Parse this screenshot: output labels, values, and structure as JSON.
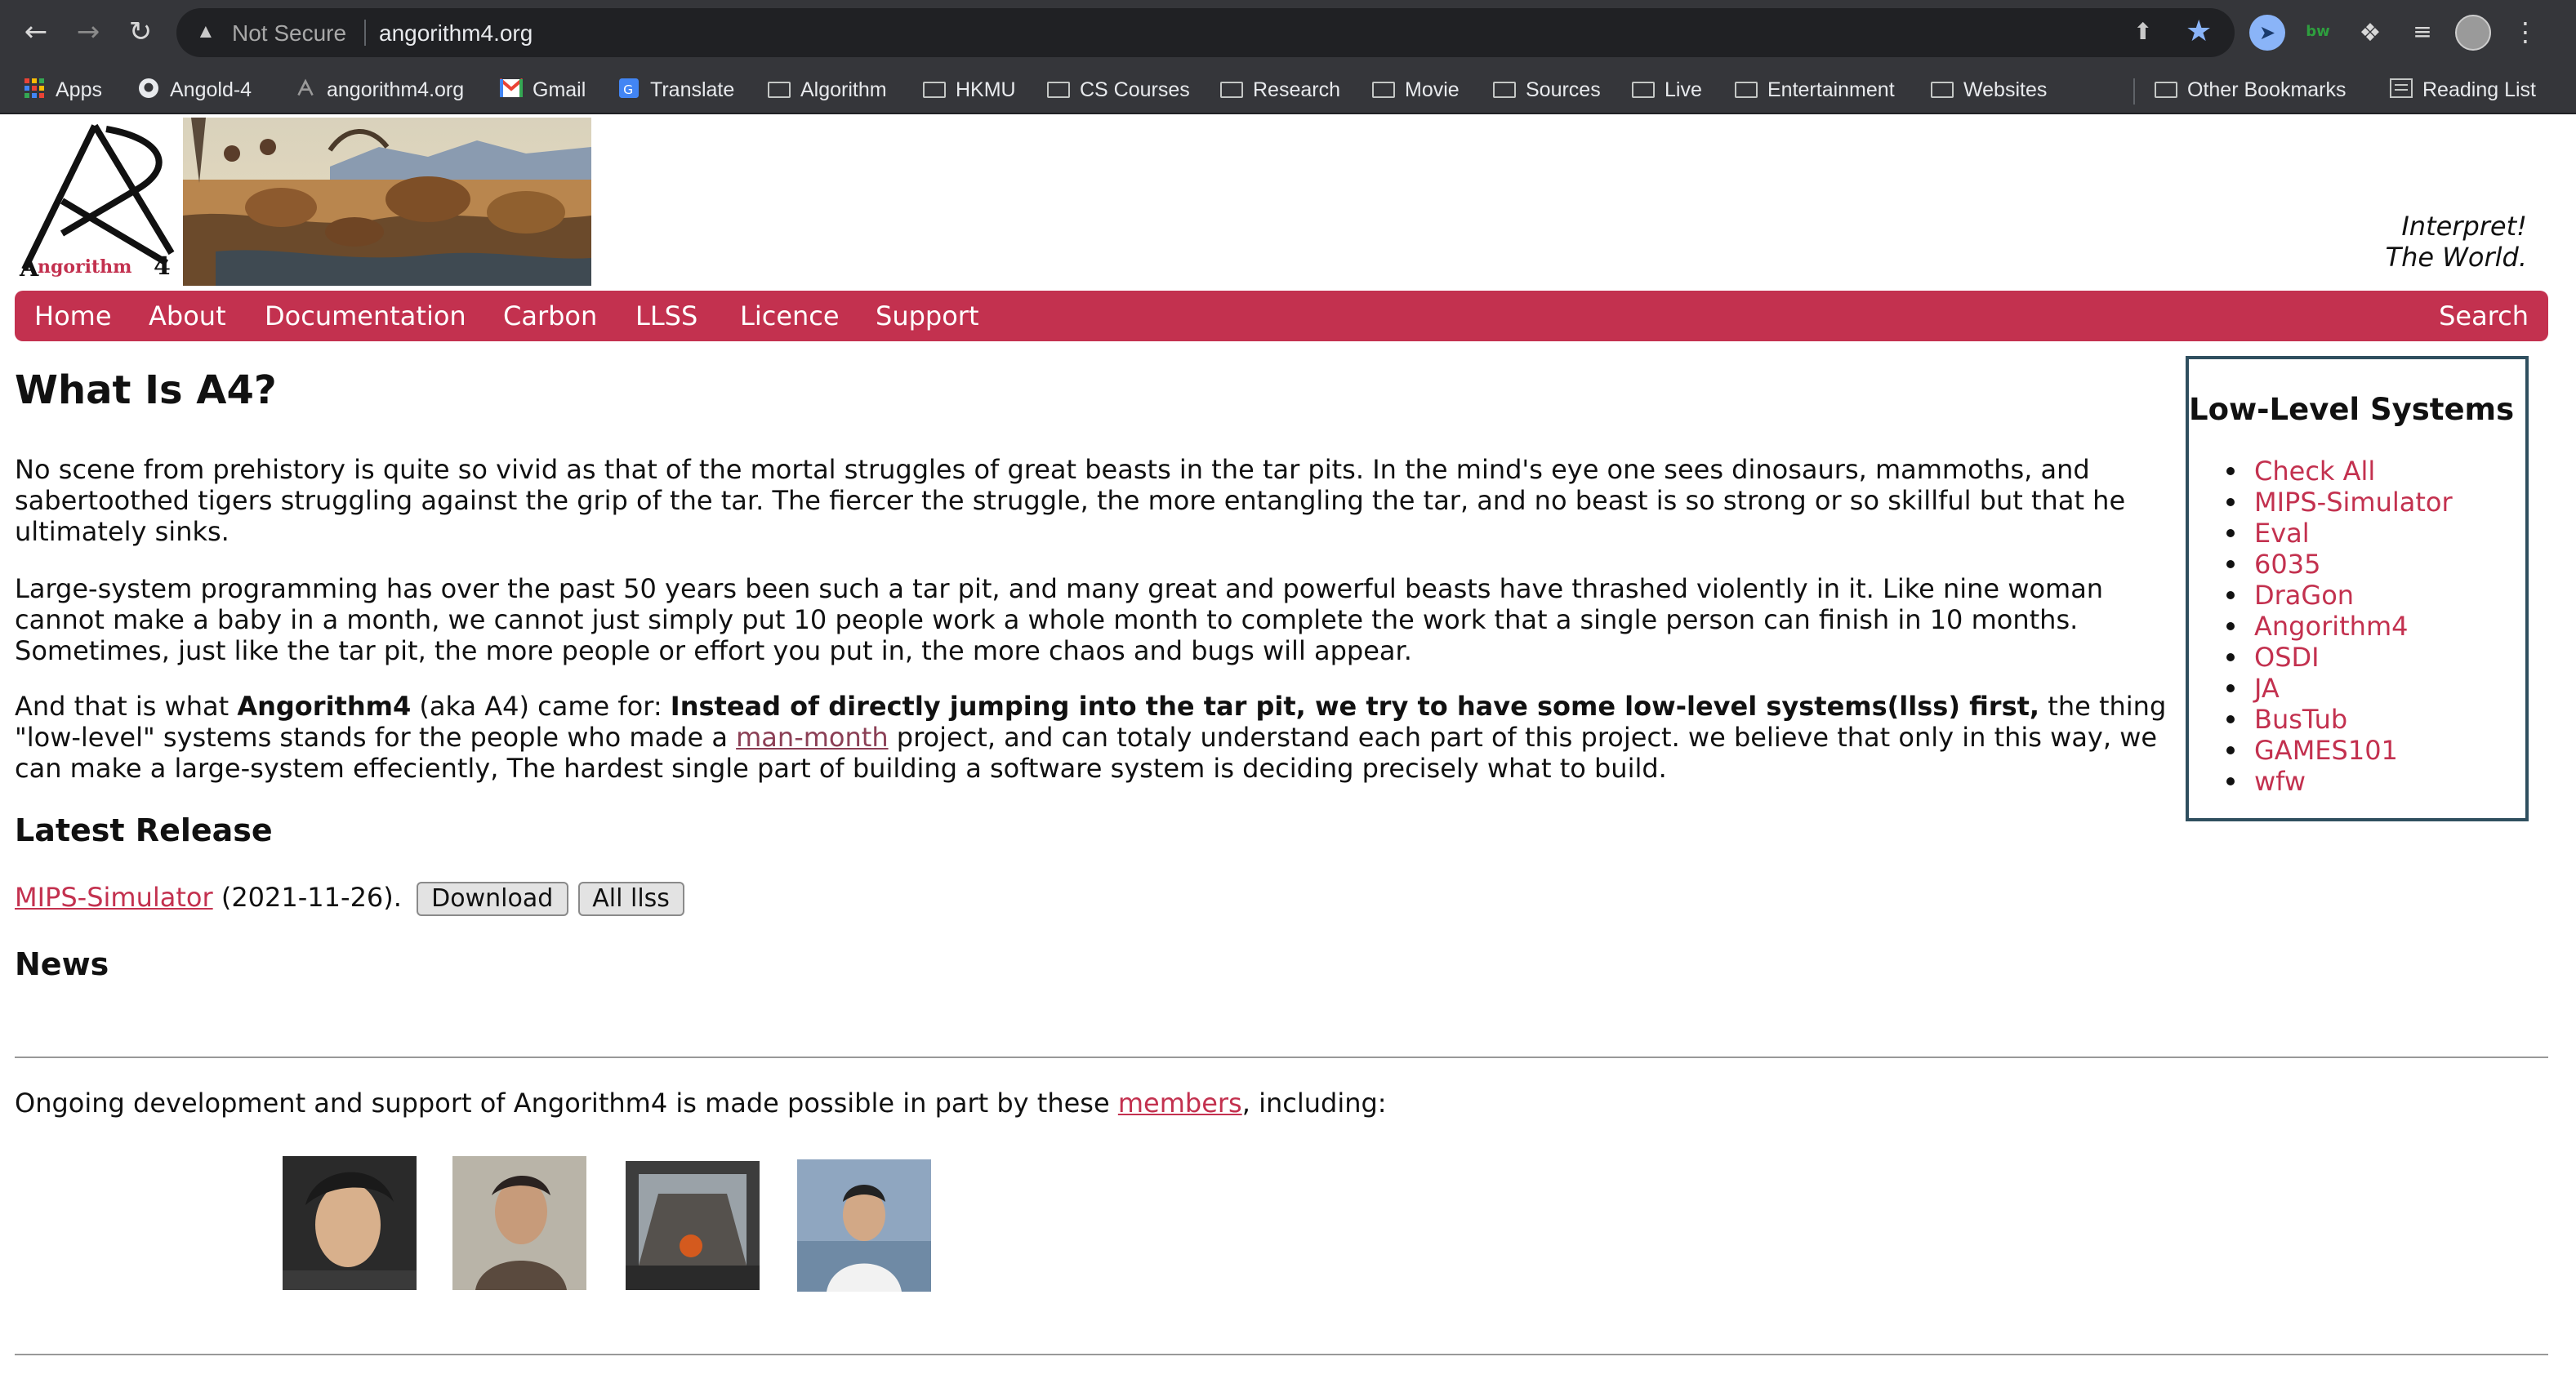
{
  "browser": {
    "security_label": "Not Secure",
    "url": "angorithm4.org",
    "extension_text": "bw",
    "bookmarks": [
      {
        "label": "Apps",
        "icon": "apps-grid-icon"
      },
      {
        "label": "Angold-4",
        "icon": "github-icon"
      },
      {
        "label": "angorithm4.org",
        "icon": "site-favicon-icon"
      },
      {
        "label": "Gmail",
        "icon": "gmail-icon"
      },
      {
        "label": "Translate",
        "icon": "translate-icon"
      },
      {
        "label": "Algorithm",
        "icon": "folder-icon"
      },
      {
        "label": "HKMU",
        "icon": "folder-icon"
      },
      {
        "label": "CS Courses",
        "icon": "folder-icon"
      },
      {
        "label": "Research",
        "icon": "folder-icon"
      },
      {
        "label": "Movie",
        "icon": "folder-icon"
      },
      {
        "label": "Sources",
        "icon": "folder-icon"
      },
      {
        "label": "Live",
        "icon": "folder-icon"
      },
      {
        "label": "Entertainment",
        "icon": "folder-icon"
      },
      {
        "label": "Websites",
        "icon": "folder-icon"
      }
    ],
    "other_bookmarks": "Other Bookmarks",
    "reading_list": "Reading List"
  },
  "site": {
    "logo_text": "Angorithm4",
    "tagline_line1": "Interpret!",
    "tagline_line2": "The World.",
    "nav": [
      "Home",
      "About",
      "Documentation",
      "Carbon",
      "LLSS",
      "Licence",
      "Support"
    ],
    "nav_search": "Search"
  },
  "main": {
    "title": "What Is A4?",
    "para1": "No scene from prehistory is quite so vivid as that of the mortal struggles of great beasts in the tar pits. In the mind's eye one sees dinosaurs, mammoths, and sabertoothed tigers struggling against the grip of the tar. The fiercer the struggle, the more entangling the tar, and no beast is so strong or so skillful but that he ultimately sinks.",
    "para2": "Large-system programming has over the past 50 years been such a tar pit, and many great and powerful beasts have thrashed violently in it. Like nine woman cannot make a baby in a month, we cannot just simply put 10 people work a whole month to complete the work that a single person can finish in 10 months. Sometimes, just like the tar pit, the more people or effort you put in, the more chaos and bugs will appear.",
    "para3_a": "And that is what ",
    "para3_b": "Angorithm4",
    "para3_c": " (aka A4) came for: ",
    "para3_d": "Instead of directly jumping into the tar pit, we try to have some low-level systems(llss) first,",
    "para3_e": " the thing \"low-level\" systems stands for the people who made a ",
    "para3_link": "man-month",
    "para3_f": " project, and can totaly understand each part of this project. we believe that only in this way, we can make a large-system effeciently, The hardest single part of building a software system is deciding precisely what to build.",
    "latest_heading": "Latest Release",
    "release_link": "MIPS-Simulator",
    "release_date": " (2021-11-26). ",
    "download_button": "Download",
    "all_button": "All llss",
    "news_heading": "News",
    "support_a": "Ongoing development and support of Angorithm4 is made possible in part by these ",
    "support_link": "members",
    "support_b": ", including:"
  },
  "sidebar": {
    "title": "Low-Level Systems",
    "items": [
      "Check All",
      "MIPS-Simulator",
      "Eval",
      "6035",
      "DraGon",
      "Angorithm4",
      "OSDI",
      "JA",
      "BusTub",
      "GAMES101",
      "wfw"
    ]
  },
  "colors": {
    "accent": "#c3314f",
    "chrome_dark": "#35363a",
    "sidebar_border": "#2f4f5f"
  }
}
